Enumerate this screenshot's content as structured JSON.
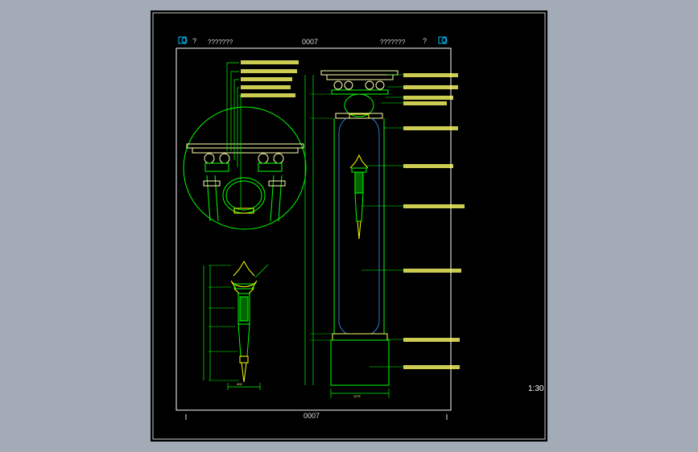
{
  "header": {
    "left_text": "???????",
    "left_mark": "?",
    "center_code": "0007",
    "right_text": "???????",
    "right_mark": "?"
  },
  "footer": {
    "center_code": "0007"
  },
  "viewport": {
    "scale_label": "1:30"
  },
  "colors": {
    "background": "#a3abb6",
    "sheet": "#000000",
    "line": "#00ff00",
    "accent": "#ffff00",
    "frame": "#ffffff"
  },
  "drawing": {
    "bottom_dims": {
      "lamp_width": "400",
      "column_width": "1175"
    },
    "annotations_count_note": "callout labels rendered as illegible Chinese glyph blocks"
  }
}
